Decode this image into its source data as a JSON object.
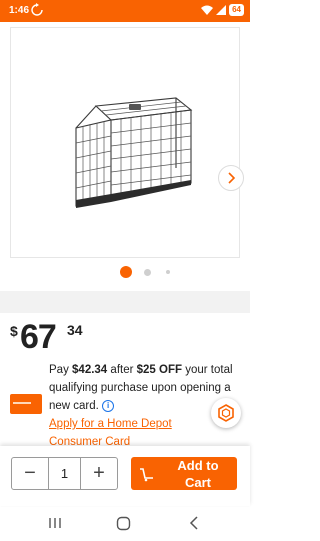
{
  "status_bar": {
    "time": "1:46",
    "battery": "64",
    "icons": [
      "sync-icon",
      "wifi-icon",
      "signal-icon",
      "battery-icon"
    ]
  },
  "gallery": {
    "image_name": "dog-crate",
    "active_index": 0,
    "dot_count": 3
  },
  "price": {
    "currency": "$",
    "dollars": "67",
    "cents": "34"
  },
  "promo": {
    "pre": "Pay",
    "amount": "$42.34",
    "mid": "after",
    "discount": "$25 OFF",
    "post": "your total qualifying purchase upon opening a new card.",
    "info_icon_glyph": "i",
    "link": "Apply for a Home Depot Consumer Card"
  },
  "quantity": {
    "value": "1",
    "minus": "−",
    "plus": "+"
  },
  "cart": {
    "label": "Add to Cart"
  },
  "colors": {
    "accent": "#f96302",
    "link": "#1a73e8"
  }
}
